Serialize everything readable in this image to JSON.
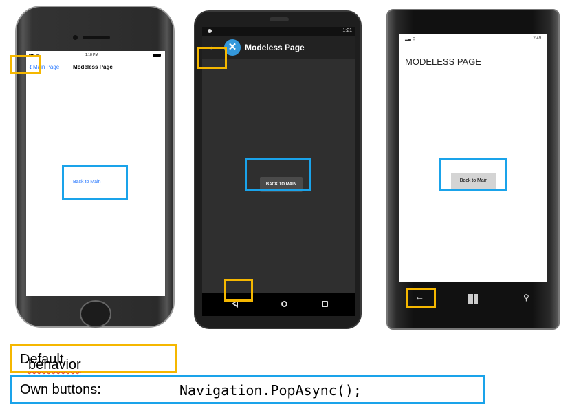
{
  "colors": {
    "default_behavior_box": "#f5b700",
    "own_buttons_box": "#1aa3ea",
    "ios_accent": "#2979ff",
    "xamarin_blue": "#3498db"
  },
  "ios": {
    "time": "1:18 PM",
    "back_label": "Main Page",
    "title": "Modeless Page",
    "button": "Back to Main"
  },
  "android": {
    "status_time": "1:21",
    "back_icon": "arrow-left-icon",
    "title": "Modeless Page",
    "button": "BACK TO MAIN"
  },
  "winphone": {
    "status_time": "2:49",
    "title": "MODELESS PAGE",
    "button": "Back to Main"
  },
  "legend": {
    "default_behavior": "Default behavior",
    "own_buttons": "Own buttons:",
    "code": "Navigation.PopAsync();"
  }
}
